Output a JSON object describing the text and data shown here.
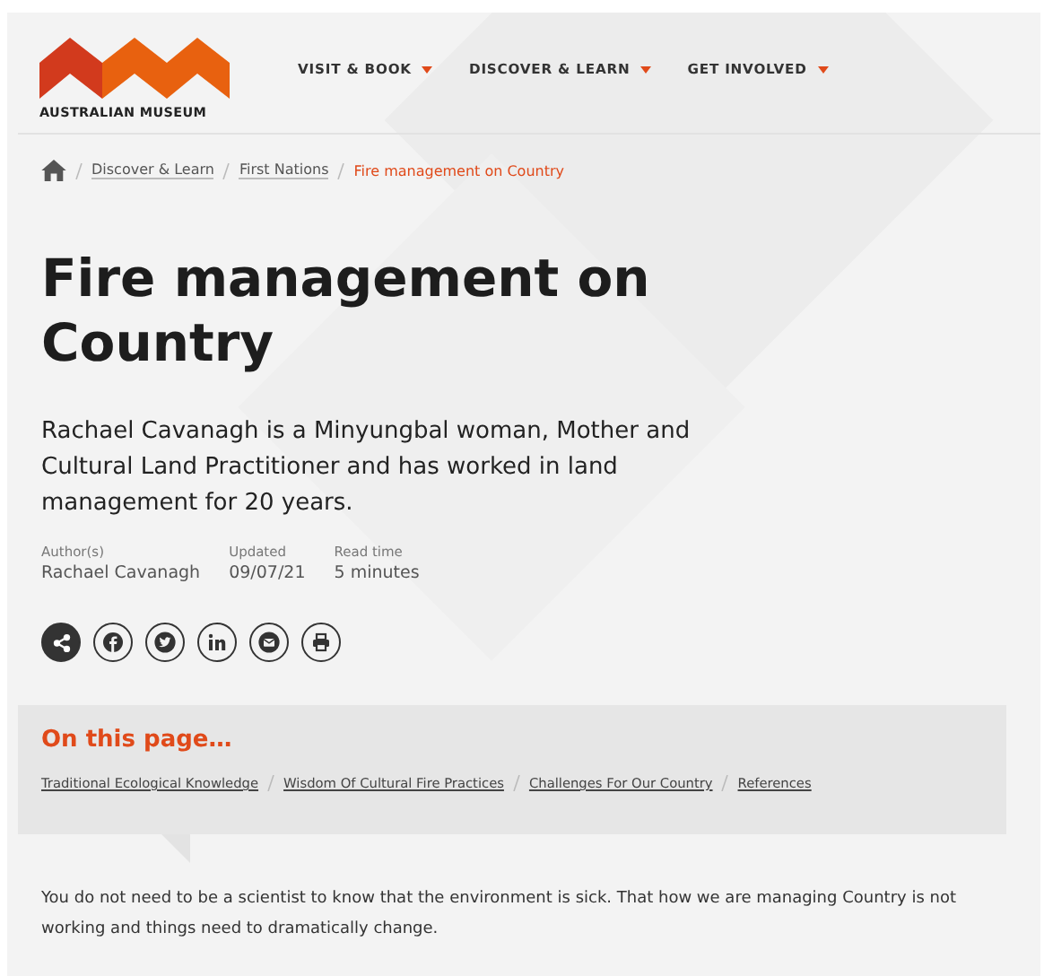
{
  "header": {
    "logo_text": "AUSTRALIAN MUSEUM",
    "nav": [
      {
        "label": "VISIT & BOOK"
      },
      {
        "label": "DISCOVER & LEARN"
      },
      {
        "label": "GET INVOLVED"
      }
    ]
  },
  "breadcrumb": {
    "links": [
      "Discover & Learn",
      "First Nations"
    ],
    "current": "Fire management on Country"
  },
  "title": "Fire management on Country",
  "lead": "Rachael Cavanagh is a Minyungbal woman, Mother and Cultural Land Practitioner and has worked in land management for 20 years.",
  "meta": [
    {
      "label": "Author(s)",
      "value": "Rachael Cavanagh"
    },
    {
      "label": "Updated",
      "value": "09/07/21"
    },
    {
      "label": "Read time",
      "value": "5 minutes"
    }
  ],
  "share": [
    {
      "kind": "share"
    },
    {
      "kind": "facebook"
    },
    {
      "kind": "twitter"
    },
    {
      "kind": "linkedin"
    },
    {
      "kind": "email"
    },
    {
      "kind": "print"
    }
  ],
  "on_this_page": {
    "heading": "On this page…",
    "links": [
      "Traditional Ecological Knowledge",
      "Wisdom Of Cultural Fire Practices",
      "Challenges For Our Country",
      "References"
    ]
  },
  "body": "You do not need to be a scientist to know that the environment is sick. That how we are managing Country is not working and things need to dramatically change."
}
